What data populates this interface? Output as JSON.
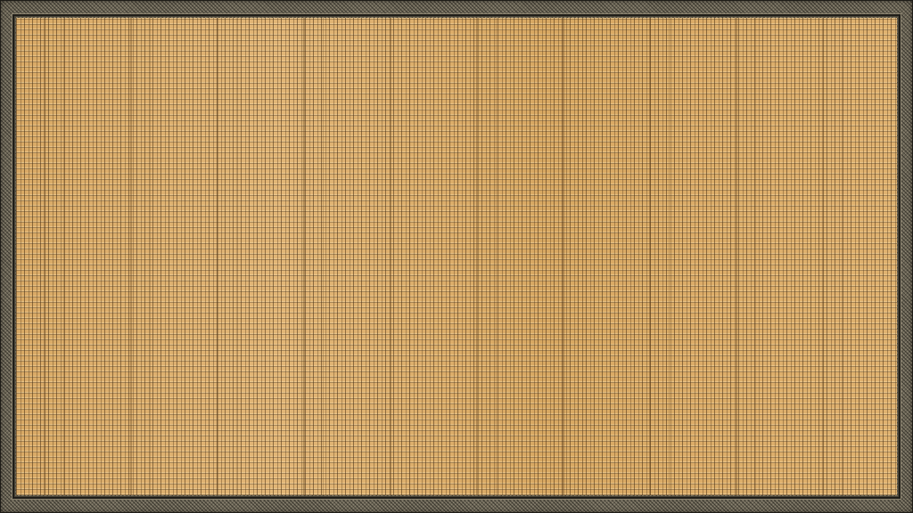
{
  "colors": {
    "straw": "#dcae6c",
    "border": "#6b6556",
    "edge": "#1f1d18"
  }
}
